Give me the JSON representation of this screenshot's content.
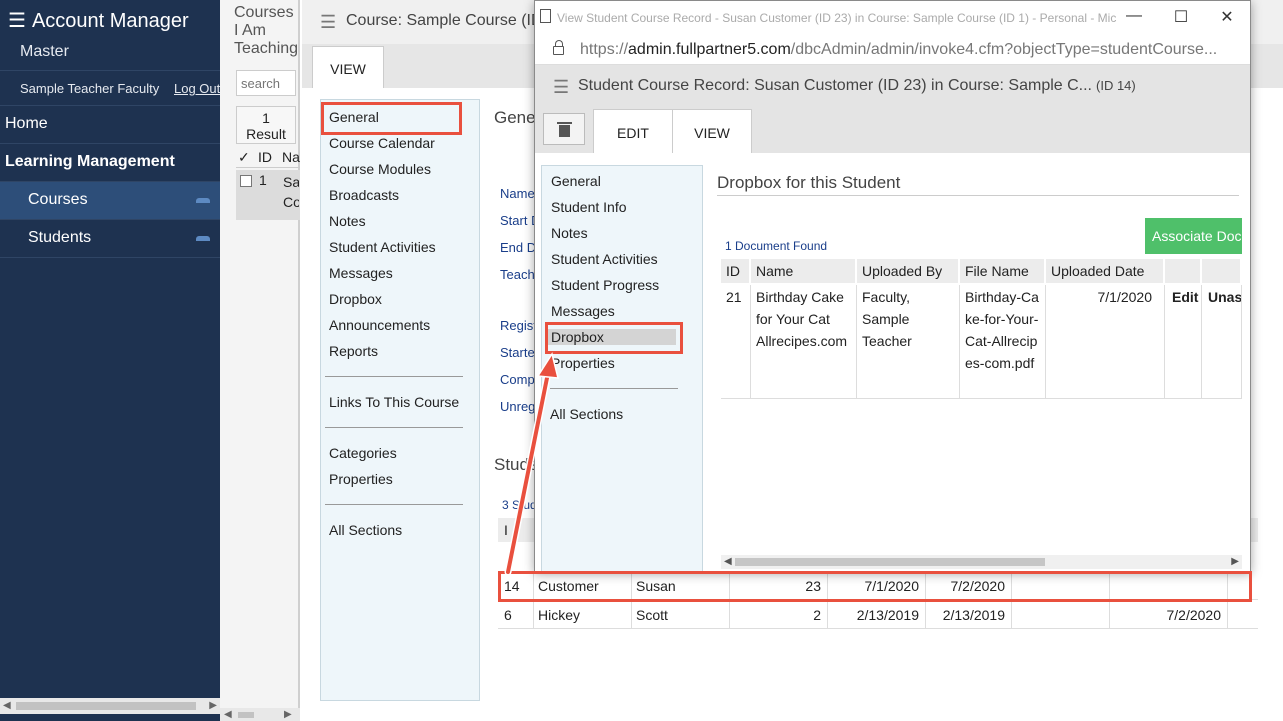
{
  "sidebar": {
    "title": "Account Manager",
    "subtitle": "Master",
    "user_name": "Sample Teacher Faculty",
    "logout": "Log Out",
    "items": [
      {
        "label": "Home"
      },
      {
        "label": "Learning Management"
      },
      {
        "label": "Courses"
      },
      {
        "label": "Students"
      }
    ]
  },
  "midcol": {
    "header": "Courses I Am Teaching",
    "search_placeholder": "search",
    "result_count": "1",
    "result_label": "Result",
    "check_col": "✓",
    "id_col": "ID",
    "name_col": "Na",
    "row_id": "1",
    "row_name": "Sa Co"
  },
  "main": {
    "title": "Course: Sample Course (ID",
    "tab_view": "VIEW",
    "nav": [
      "General",
      "Course Calendar",
      "Course Modules",
      "Broadcasts",
      "Notes",
      "Student Activities",
      "Messages",
      "Dropbox",
      "Announcements",
      "Reports",
      "Links To This Course",
      "Categories",
      "Properties",
      "All Sections"
    ],
    "general_heading": "Gene",
    "fields": [
      "Name",
      "Start D",
      "End D",
      "Teach",
      "Regist",
      "Starte",
      "Comp",
      "Unreg"
    ],
    "students_heading": "Stude",
    "students_count": "3 Stud",
    "student_header_first": "I",
    "students": [
      {
        "id": "14",
        "last": "Customer",
        "first": "Susan",
        "num": "23",
        "d1": "7/1/2020",
        "d2": "7/2/2020",
        "d3": ""
      },
      {
        "id": "6",
        "last": "Hickey",
        "first": "Scott",
        "num": "2",
        "d1": "2/13/2019",
        "d2": "2/13/2019",
        "d3": "7/2/2020"
      }
    ]
  },
  "popup": {
    "window_title": "View Student Course Record - Susan Customer (ID 23) in Course: Sample Course (ID 1) - Personal - Mic...",
    "url_prefix": "https://",
    "url_host": "admin.fullpartner5.com",
    "url_path": "/dbcAdmin/admin/invoke4.cfm?objectType=studentCourse...",
    "heading": "Student Course Record: Susan Customer (ID 23) in Course: Sample C...",
    "heading_id": "(ID 14)",
    "tab_edit": "EDIT",
    "tab_view": "VIEW",
    "nav": [
      "General",
      "Student Info",
      "Notes",
      "Student Activities",
      "Student Progress",
      "Messages",
      "Dropbox",
      "Properties",
      "All Sections"
    ],
    "dropbox_heading": "Dropbox for this Student",
    "associate_button": "Associate Doc",
    "doc_found": "1 Document Found",
    "columns": [
      "ID",
      "Name",
      "Uploaded By",
      "File Name",
      "Uploaded Date",
      "",
      ""
    ],
    "doc": {
      "id": "21",
      "name": "Birthday Cake for Your Cat Allrecipes.com",
      "uploaded_by": "Faculty, Sample Teacher",
      "file_name": "Birthday-Cake-for-Your-Cat-Allrecipes-com.pdf",
      "uploaded_date": "7/1/2020",
      "edit": "Edit",
      "unassign": "Unas"
    }
  },
  "colors": {
    "sidebar": "#1e3250",
    "highlight": "#e9503e",
    "accent_green": "#4fc06a"
  }
}
